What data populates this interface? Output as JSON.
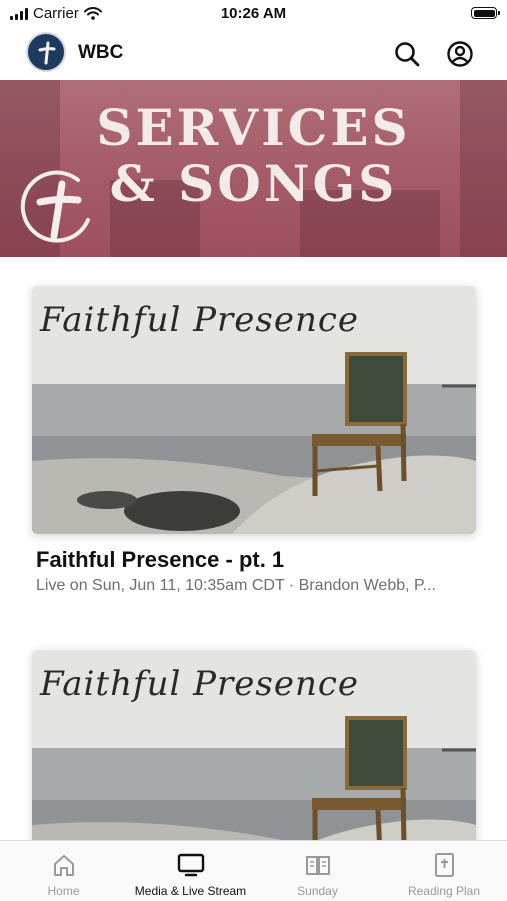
{
  "status_bar": {
    "carrier": "Carrier",
    "time": "10:26 AM"
  },
  "header": {
    "app_name": "WBC",
    "icons": [
      "logo-cross-icon",
      "search-icon",
      "account-icon"
    ]
  },
  "banner": {
    "line1": "SERVICES",
    "line2": "& SONGS"
  },
  "media_items": [
    {
      "thumbnail_script": "Faithful Presence",
      "title": "Faithful Presence - pt. 1",
      "subtitle": "Live on Sun, Jun 11, 10:35am CDT · Brandon Webb, P..."
    },
    {
      "thumbnail_script": "Faithful Presence"
    }
  ],
  "tab_bar": {
    "tabs": [
      {
        "label": "Home",
        "icon": "home-icon"
      },
      {
        "label": "Media & Live Stream",
        "icon": "tv-icon",
        "active": true
      },
      {
        "label": "Sunday",
        "icon": "open-book-icon"
      },
      {
        "label": "Reading Plan",
        "icon": "bible-icon"
      }
    ]
  },
  "colors": {
    "banner": "#a65e6a",
    "header_logo": "#1e3a5f",
    "active_tab": "#111111",
    "inactive_tab": "#9a9a9a"
  }
}
